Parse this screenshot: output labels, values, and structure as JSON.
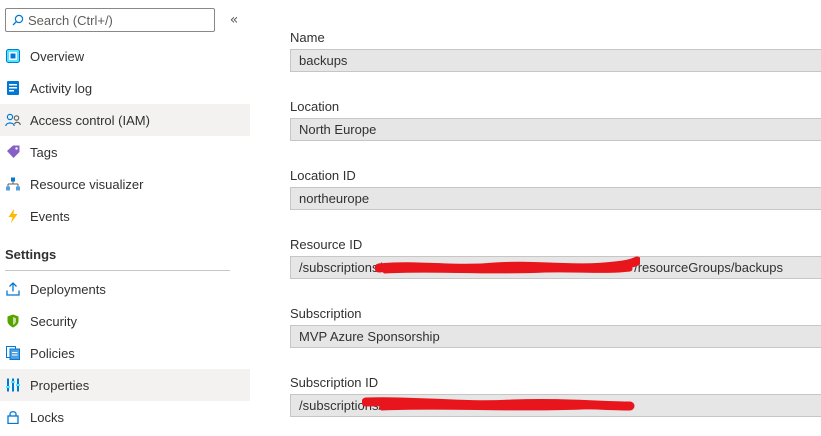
{
  "sidebar": {
    "search": {
      "placeholder": "Search (Ctrl+/)",
      "value": ""
    },
    "collapse_glyph": "«",
    "items": [
      {
        "label": "Overview",
        "icon": "overview-icon"
      },
      {
        "label": "Activity log",
        "icon": "activity-log-icon"
      },
      {
        "label": "Access control (IAM)",
        "icon": "people-icon",
        "selected": true
      },
      {
        "label": "Tags",
        "icon": "tag-icon"
      },
      {
        "label": "Resource visualizer",
        "icon": "hierarchy-icon"
      },
      {
        "label": "Events",
        "icon": "lightning-icon"
      }
    ],
    "settings_title": "Settings",
    "settings_items": [
      {
        "label": "Deployments",
        "icon": "upload-icon"
      },
      {
        "label": "Security",
        "icon": "shield-icon"
      },
      {
        "label": "Policies",
        "icon": "policy-icon"
      },
      {
        "label": "Properties",
        "icon": "properties-icon",
        "selected": true
      },
      {
        "label": "Locks",
        "icon": "lock-icon"
      }
    ]
  },
  "properties": {
    "name": {
      "label": "Name",
      "value": "backups"
    },
    "location": {
      "label": "Location",
      "value": "North Europe"
    },
    "location_id": {
      "label": "Location ID",
      "value": "northeurope"
    },
    "resource_id": {
      "label": "Resource ID",
      "prefix": "/subscriptions/",
      "suffix": "/resourceGroups/backups"
    },
    "subscription": {
      "label": "Subscription",
      "value": "MVP Azure Sponsorship"
    },
    "subscription_id": {
      "label": "Subscription ID",
      "prefix": "/subscriptions/"
    }
  },
  "colors": {
    "selected_bg": "#f3f2f1",
    "field_bg": "#e6e6e6",
    "redaction": "#e8161c",
    "azure_blue": "#0078d4"
  }
}
